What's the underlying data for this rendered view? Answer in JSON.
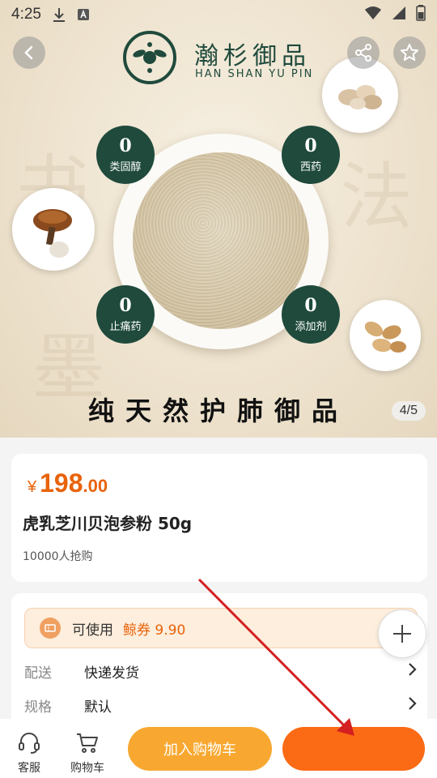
{
  "status_bar": {
    "time": "4:25"
  },
  "brand": {
    "name_cn": "瀚杉御品",
    "name_en": "HAN SHAN YU PIN"
  },
  "hero": {
    "badges": [
      {
        "num": "0",
        "label": "类固醇"
      },
      {
        "num": "0",
        "label": "西药"
      },
      {
        "num": "0",
        "label": "止痛药"
      },
      {
        "num": "0",
        "label": "添加剂"
      }
    ],
    "slogan": "纯天然护肺御品",
    "page_indicator": "4/5"
  },
  "product": {
    "currency": "¥",
    "price_int": "198",
    "price_dec": ".00",
    "title": "虎乳芝川贝泡参粉 50g",
    "sales": "10000人抢购"
  },
  "coupon": {
    "label": "可使用",
    "value": "鲸券 9.90"
  },
  "rows": [
    {
      "key": "配送",
      "value": "快递发货"
    },
    {
      "key": "规格",
      "value": "默认"
    }
  ],
  "bottom_bar": {
    "service_label": "客服",
    "cart_label": "购物车",
    "add_to_cart": "加入购物车",
    "buy_now": ""
  },
  "colors": {
    "accent": "#e8630a",
    "brand_green": "#1f4a3c",
    "cart_button": "#f8a830",
    "buy_button": "#fb6a14"
  }
}
